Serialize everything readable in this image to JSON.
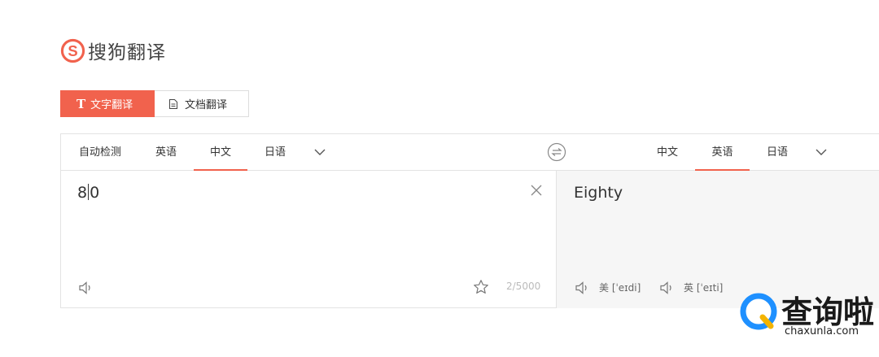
{
  "logo": {
    "text": "搜狗翻译",
    "icon": "sogou-s-logo",
    "brand_color": "#f1624d"
  },
  "mode_tabs": [
    {
      "label": "文字翻译",
      "icon": "text-t-icon",
      "active": true
    },
    {
      "label": "文档翻译",
      "icon": "document-icon",
      "active": false
    }
  ],
  "source_langs": [
    {
      "label": "自动检测",
      "active": false
    },
    {
      "label": "英语",
      "active": false
    },
    {
      "label": "中文",
      "active": true
    },
    {
      "label": "日语",
      "active": false
    }
  ],
  "target_langs": [
    {
      "label": "中文",
      "active": false
    },
    {
      "label": "英语",
      "active": true
    },
    {
      "label": "日语",
      "active": false
    }
  ],
  "source": {
    "text_before_caret": "8",
    "text_after_caret": "0",
    "char_count": "2/5000"
  },
  "target": {
    "text": "Eighty",
    "phonetics": [
      {
        "label": "美 [ˈeɪdi]"
      },
      {
        "label": "英 [ˈeɪti]"
      }
    ]
  },
  "watermark": {
    "title": "查询啦",
    "url": "chaxunla.com",
    "color": "#1e90ff"
  },
  "colors": {
    "accent": "#f1624d",
    "border": "#e3e3e3",
    "target_bg": "#f6f6f6",
    "muted": "#bbbbbb"
  }
}
